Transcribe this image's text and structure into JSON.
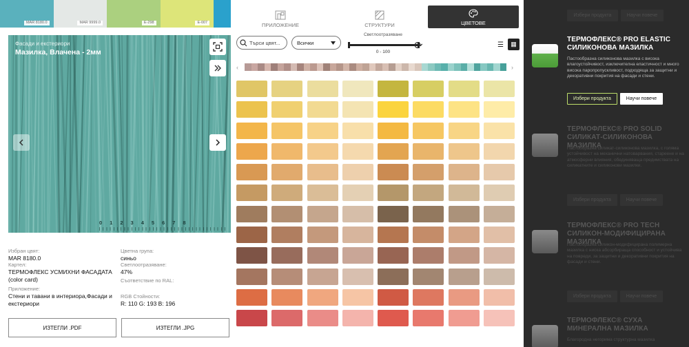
{
  "top_strip": [
    {
      "color": "#5ab1bd",
      "code": "MAR 8180.0"
    },
    {
      "color": "#e4e8e6",
      "code": "MAR 9999.0"
    },
    {
      "color": "#abd07f",
      "code": "E-298"
    },
    {
      "color": "#dde579",
      "code": "E-007"
    },
    {
      "color": "#2aa1cc",
      "code": ""
    }
  ],
  "texture": {
    "category": "Фасади и екстериори",
    "name": "Мазилка, Влачена - 2мм",
    "color": "#5fa9a1",
    "ruler": [
      "0",
      "1",
      "2",
      "3",
      "4",
      "5",
      "6",
      "7",
      "8"
    ]
  },
  "icons": {
    "fullscreen": "fullscreen-icon",
    "expand": "chevrons-right-icon",
    "prev": "chevron-left-icon",
    "next": "chevron-right-icon"
  },
  "info": {
    "selected_label": "Избран цвят:",
    "selected_value": "MAR 8180.0",
    "card_label": "Картел:",
    "card_value": "ТЕРМОФЛЕКС УСМИХНИ ФАСАДАТА (color card)",
    "application_label": "Приложение:",
    "application_value": "Стени и тавани в интериора,Фасади и екстериори",
    "group_label": "Цветна група:",
    "group_value": "синьо",
    "lr_label": "Светлоотразяване:",
    "lr_value": "47%",
    "ral_label": "Съответствие по RAL:",
    "rgb_label": "RGB Стойности:",
    "rgb_value": "R: 110 G: 193 B: 196"
  },
  "downloads": {
    "pdf": "ИЗТЕГЛИ .PDF",
    "jpg": "ИЗТЕГЛИ .JPG"
  },
  "tabs": {
    "application": "ПРИЛОЖЕНИЕ",
    "structures": "СТРУКТУРИ",
    "colors": "ЦВЕТОВЕ"
  },
  "filters": {
    "search_placeholder": "Търси цвят...",
    "group_selected": "Всички",
    "lr_title": "Светлоотразяване",
    "lr_range": "0 - 100"
  },
  "palette_strip": [
    "#b79a96",
    "#c9a7a2",
    "#a98a85",
    "#d7b7ae",
    "#9f807a",
    "#c5a49c",
    "#b08f88",
    "#d4bab2",
    "#a5847c",
    "#cfb1a5",
    "#bb9a90",
    "#dcc2b8",
    "#a08278",
    "#c8a79b",
    "#b49589",
    "#d2b5a8",
    "#aa8b80",
    "#cdaea0",
    "#bfa395",
    "#e0c8bc",
    "#c3a89c",
    "#d8bfb3",
    "#b59d92",
    "#e3d1c6",
    "#ccb7ab",
    "#e8d9cf",
    "#d9c6ba",
    "#a8d8d2",
    "#8cc9c1",
    "#6dbab4",
    "#58b0ab",
    "#9ad2cc",
    "#7cc2bb",
    "#5aaea8",
    "#b4e0da",
    "#4fa49e",
    "#86c8c2",
    "#68b7b0",
    "#a2d6d0",
    "#47a09a"
  ],
  "swatches": [
    [
      "#e0c666",
      "#e6d281",
      "#ebdd9e",
      "#f0e7bd",
      "#c4b63f",
      "#d7ce63",
      "#e3dc87",
      "#ebe5a7"
    ],
    [
      "#ecc34e",
      "#f0d070",
      "#f2da92",
      "#f4e4b3",
      "#fbd43f",
      "#fcdb63",
      "#fde385",
      "#feeca8"
    ],
    [
      "#f3b64a",
      "#f5c567",
      "#f7d287",
      "#f8dfaa",
      "#f4b942",
      "#f6c762",
      "#f8d585",
      "#fae2a8"
    ],
    [
      "#eda74c",
      "#f0b86b",
      "#f3c98c",
      "#f5d9ae",
      "#e3a551",
      "#e9b56b",
      "#eec68b",
      "#f2d6ad"
    ],
    [
      "#d99953",
      "#e1aa6d",
      "#e8bd8c",
      "#eed0ad",
      "#cb8b52",
      "#d49f6b",
      "#ddb48b",
      "#e6c9ab"
    ],
    [
      "#c59a63",
      "#cfab7b",
      "#dabd97",
      "#e4d0b4",
      "#b4976a",
      "#c3a77f",
      "#d1b998",
      "#dfccb2"
    ],
    [
      "#9f7c5e",
      "#b28f73",
      "#c5a68d",
      "#d6bea9",
      "#7a634c",
      "#93795f",
      "#ab927a",
      "#c5ae98"
    ],
    [
      "#9c6547",
      "#b07e60",
      "#c4997c",
      "#d7b59d",
      "#b57650",
      "#c48c69",
      "#d3a587",
      "#e1bfa7"
    ],
    [
      "#7e5446",
      "#986c5c",
      "#b18878",
      "#c9a697",
      "#986553",
      "#ac7d6b",
      "#c19986",
      "#d5b6a5"
    ],
    [
      "#a47660",
      "#b68d78",
      "#c7a592",
      "#d8bfaf",
      "#8c6e59",
      "#a28671",
      "#b89f8d",
      "#cdbbab"
    ],
    [
      "#dd6d44",
      "#e88a5e",
      "#f0a77f",
      "#f6c5a5",
      "#d05a44",
      "#de7860",
      "#e99a82",
      "#f1bea9"
    ],
    [
      "#c9474a",
      "#dc6a6a",
      "#ea8c88",
      "#f4b4ac",
      "#df5a4e",
      "#e8796d",
      "#f09c91",
      "#f6c2b9"
    ]
  ],
  "products": [
    {
      "title": "",
      "desc": "",
      "select": "Избери продукта",
      "learn": "Научи повече",
      "active": false
    },
    {
      "title": "ТЕРМОФЛЕКС® PRO ELASTIC СИЛИКОНОВА МАЗИЛКА",
      "desc": "Пастообразна силиконова мазилка с висока влагоустойчивост, изключителна еластичност и много висока паропропускливост, подходяща за защитни и декоративни покрития на фасади и стени.",
      "select": "Избери продукта",
      "learn": "Научи повече",
      "active": true
    },
    {
      "title": "ТЕРМОФЛЕКС® PRO SOLID СИЛИКАТ-СИЛИКОНОВА МАЗИЛКА",
      "desc": "Пастообразна силикат-силиконова мазилка, с голяма устойчивост на механични натоварвания, стареене и на атмосферни влияния, обединяваща предимствата на силикатните и силиконови мазилки.",
      "select": "Избери продукта",
      "learn": "Научи повече",
      "active": false
    },
    {
      "title": "ТЕРМОФЛЕКС® PRO TECH СИЛИКОН-МОДИФИЦИРАНА МАЗИЛКА",
      "desc": "Пастообразна силикон-модифицирана полимерна мазилка с ниска абсорбираща способност и устойчива на повреди, за защитни и декоративни покрития на фасади и стени.",
      "select": "Избери продукта",
      "learn": "Научи повече",
      "active": false
    },
    {
      "title": "ТЕРМОФЛЕКС® СУХА МИНЕРАЛНА МАЗИЛКА",
      "desc": "Благородна негорима структурна мазилка",
      "select": "",
      "learn": "",
      "active": false
    }
  ]
}
